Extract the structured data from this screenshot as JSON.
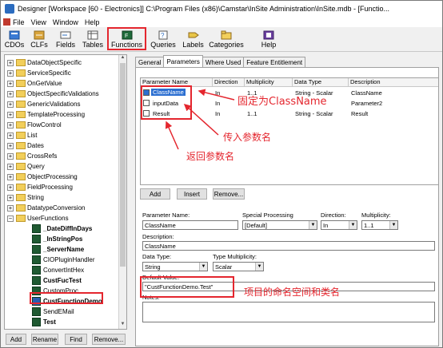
{
  "window": {
    "title": "Designer [Workspace [60 - Electronics]]  C:\\Program Files (x86)\\Camstar\\InSite Administration\\InSite.mdb - [Functio..."
  },
  "menu": [
    "File",
    "View",
    "Window",
    "Help"
  ],
  "toolbar": {
    "items": [
      {
        "label": "CDOs",
        "icon": "cdo-icon"
      },
      {
        "label": "CLFs",
        "icon": "clf-icon"
      },
      {
        "label": "Fields",
        "icon": "fields-icon"
      },
      {
        "label": "Tables",
        "icon": "tables-icon"
      },
      {
        "label": "Functions",
        "icon": "functions-icon",
        "highlighted": true
      },
      {
        "label": "Queries",
        "icon": "queries-icon"
      },
      {
        "label": "Labels",
        "icon": "labels-icon"
      },
      {
        "label": "Categories",
        "icon": "categories-icon"
      },
      {
        "label": "Help",
        "icon": "help-icon"
      }
    ]
  },
  "tree": {
    "folders": [
      "DataObjectSpecific",
      "ServiceSpecific",
      "OnGetValue",
      "ObjectSpecificValidations",
      "GenericValidations",
      "TemplateProcessing",
      "FlowControl",
      "List",
      "Dates",
      "CrossRefs",
      "Query",
      "ObjectProcessing",
      "FieldProcessing",
      "String",
      "DatatypeConversion",
      "UserFunctions"
    ],
    "functions": [
      {
        "label": "_DateDiffInDays",
        "bold": true
      },
      {
        "label": "_InStringPos",
        "bold": true
      },
      {
        "label": "_ServerName",
        "bold": true
      },
      {
        "label": "CIOPluginHandler",
        "bold": false
      },
      {
        "label": "ConvertIntHex",
        "bold": false
      },
      {
        "label": "CustFucTest",
        "bold": true
      },
      {
        "label": "CustomProc",
        "bold": false
      },
      {
        "label": "CustFunctionDemo",
        "bold": true,
        "selected": true
      },
      {
        "label": "SendEMail",
        "bold": false
      },
      {
        "label": "Test",
        "bold": true
      }
    ],
    "buttons": {
      "add": "Add",
      "rename": "Rename",
      "find": "Find",
      "remove": "Remove..."
    }
  },
  "tabs": [
    "General",
    "Parameters",
    "Where Used",
    "Feature Entitlement"
  ],
  "active_tab": "Parameters",
  "param_table": {
    "columns": [
      "Parameter Name",
      "Direction",
      "Multiplicity",
      "Data Type",
      "Description"
    ],
    "rows": [
      {
        "name": "ClassName",
        "direction": "In",
        "multiplicity": "1..1",
        "datatype": "String - Scalar",
        "description": "ClassName",
        "selected": true
      },
      {
        "name": "inputData",
        "direction": "In",
        "multiplicity": "",
        "datatype": "",
        "description": "Parameter2"
      },
      {
        "name": "Result",
        "direction": "In",
        "multiplicity": "1..1",
        "datatype": "String - Scalar",
        "description": "Result"
      }
    ],
    "buttons": {
      "add": "Add",
      "insert": "Insert",
      "remove": "Remove..."
    }
  },
  "form": {
    "parameter_name_label": "Parameter Name:",
    "parameter_name": "ClassName",
    "special_processing_label": "Special Processing",
    "special_processing": "[Default]",
    "direction_label": "Direction:",
    "direction": "In",
    "multiplicity_label": "Multiplicity:",
    "multiplicity": "1..1",
    "description_label": "Description:",
    "description": "ClassName",
    "data_type_label": "Data Type:",
    "data_type": "String",
    "type_multiplicity_label": "Type Multiplicity:",
    "type_multiplicity": "Scalar",
    "default_value_label": "Default Value:",
    "default_value": "\"CustFunctionDemo.Test\"",
    "notes_label": "Notes:"
  },
  "annotations": {
    "fixed_classname": "固定为ClassName",
    "input_param": "传入参数名",
    "return_param": "返回参数名",
    "namespace_class": "项目的命名空间和类名"
  },
  "colors": {
    "annotation": "#e4262e",
    "selection": "#2c6fd1"
  }
}
